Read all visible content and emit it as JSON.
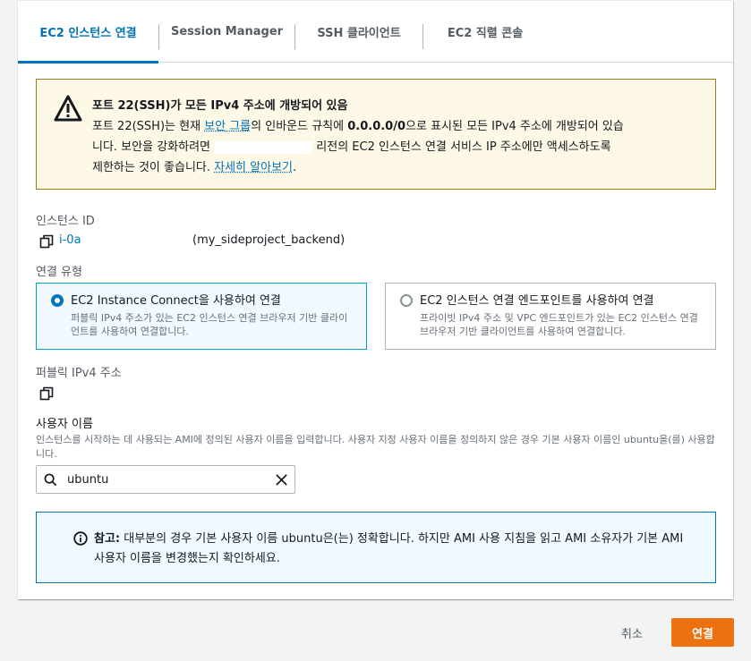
{
  "tabs": [
    {
      "label": "EC2 인스턴스 연결"
    },
    {
      "label": "Session Manager"
    },
    {
      "label": "SSH 클라이언트"
    },
    {
      "label": "EC2 직렬 콘솔"
    }
  ],
  "alert": {
    "title": "포트 22(SSH)가 모든 IPv4 주소에 개방되어 있음",
    "line1_a": "포트 22(SSH)는 현재 ",
    "line1_link": "보안 그룹",
    "line1_b": "의 인바운드 규칙에 ",
    "line1_bold": "0.0.0.0/0",
    "line1_c": "으로 표시된 모든 IPv4 주소에 개방되어 있습",
    "line2_a": "니다. 보안을 강화하려면 ",
    "line2_b": " 리전의 EC2 인스턴스 연결 서비스 IP 주소에만 액세스하도록",
    "line3_a": "제한하는 것이 좋습니다. ",
    "line3_link": "자세히 알아보기",
    "line3_b": "."
  },
  "instance": {
    "label": "인스턴스 ID",
    "id": "i-0a",
    "name": "(my_sideproject_backend)"
  },
  "connection_type": {
    "label": "연결 유형",
    "options": [
      {
        "title": "EC2 Instance Connect을 사용하여 연결",
        "desc": "퍼블릭 IPv4 주소가 있는 EC2 인스턴스 연결 브라우저 기반 클라이언트를 사용하여 연결합니다.",
        "selected": true
      },
      {
        "title": "EC2 인스턴스 연결 엔드포인트를 사용하여 연결",
        "desc": "프라이빗 IPv4 주소 및 VPC 엔드포인트가 있는 EC2 인스턴스 연결 브라우저 기반 클라이언트를 사용하여 연결합니다.",
        "selected": false
      }
    ]
  },
  "public_ip": {
    "label": "퍼블릭 IPv4 주소"
  },
  "username": {
    "label": "사용자 이름",
    "hint": "인스턴스를 시작하는 데 사용되는 AMI에 정의된 사용자 이름을 입력합니다. 사용자 지정 사용자 이름을 정의하지 않은 경우 기본 사용자 이름인 ubuntu을(를) 사용합니다.",
    "value": "ubuntu"
  },
  "note": {
    "prefix": "참고:",
    "text": " 대부분의 경우 기본 사용자 이름 ubuntu은(는) 정확합니다. 하지만 AMI 사용 지침을 읽고 AMI 소유자가 기본 AMI 사용자 이름을 변경했는지 확인하세요."
  },
  "footer": {
    "cancel": "취소",
    "connect": "연결"
  },
  "colors": {
    "accent": "#0073bb",
    "primary_button": "#ec7211",
    "warning_bg": "#fef8e7",
    "info_bg": "#f1faff"
  }
}
